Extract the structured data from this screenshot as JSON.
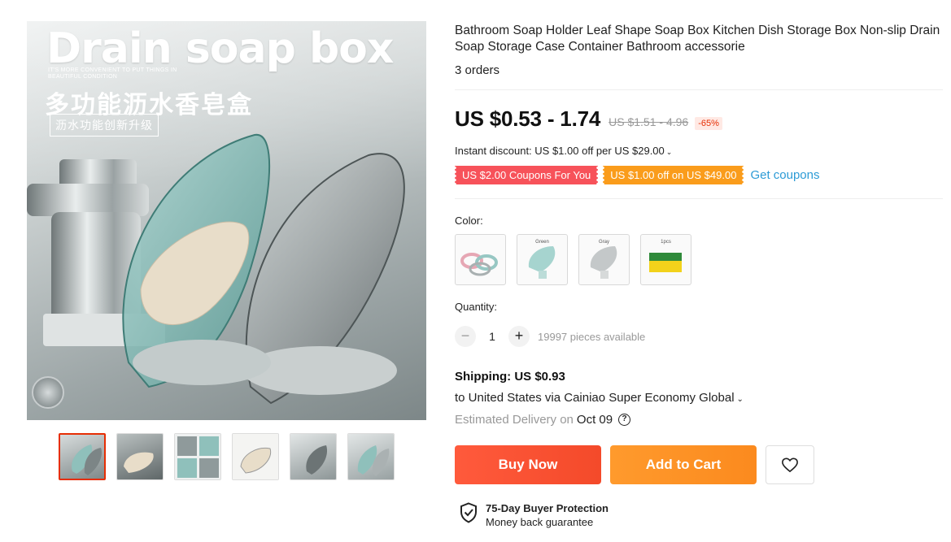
{
  "gallery": {
    "main_image": {
      "headline": "Drain soap box",
      "subline": "IT'S MORE CONVENIENT TO PUT THINGS IN BEAUTIFUL CONDITION",
      "cn_title": "多功能沥水香皂盒",
      "cn_badge": "沥水功能创新升级"
    },
    "thumbnails_count": 6,
    "active_thumbnail": 1
  },
  "product": {
    "title": "Bathroom Soap Holder Leaf Shape Soap Box Kitchen Dish Storage Box Non-slip Drain Soap Storage Case Container Bathroom accessorie",
    "orders": "3 orders"
  },
  "pricing": {
    "price": "US $0.53 - 1.74",
    "old_price": "US $1.51 - 4.96",
    "discount": "-65%",
    "instant_discount": "Instant discount: US $1.00 off per US $29.00"
  },
  "coupons": {
    "coupon1": "US $2.00 Coupons For You",
    "coupon2": "US $1.00 off on US $49.00",
    "get_link": "Get coupons"
  },
  "color": {
    "label": "Color:",
    "options": [
      {
        "caption": ""
      },
      {
        "caption": "Green"
      },
      {
        "caption": "Gray"
      },
      {
        "caption": "1pcs"
      }
    ]
  },
  "quantity": {
    "label": "Quantity:",
    "value": "1",
    "minus": "−",
    "plus": "+",
    "available": "19997 pieces available"
  },
  "shipping": {
    "cost": "Shipping: US $0.93",
    "route": "to United States via Cainiao Super Economy Global",
    "delivery_label": "Estimated Delivery on",
    "delivery_date": "Oct 09"
  },
  "actions": {
    "buy_now": "Buy Now",
    "add_to_cart": "Add to Cart"
  },
  "protection": {
    "title": "75-Day Buyer Protection",
    "subtitle": "Money back guarantee"
  },
  "colors": {
    "accent_red": "#e62e04",
    "buy_now": "#f44a2a",
    "add_to_cart": "#fb8a1e",
    "coupon_red": "#f7525a",
    "coupon_orange": "#fa9c1b",
    "link_blue": "#2c9bd6"
  }
}
